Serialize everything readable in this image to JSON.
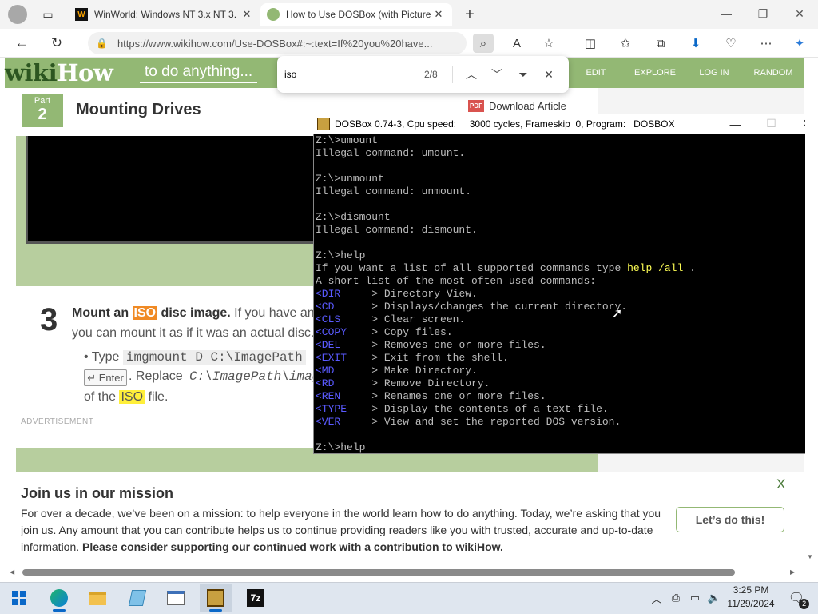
{
  "browser": {
    "tabs": [
      {
        "title": "WinWorld: Windows NT 3.x NT 3.",
        "favicon": "W",
        "active": false
      },
      {
        "title": "How to Use DOSBox (with Picture",
        "favicon": "",
        "active": true
      }
    ],
    "url": "https://www.wikihow.com/Use-DOSBox#:~:text=If%20you%20have..."
  },
  "find": {
    "query": "iso",
    "count": "2/8"
  },
  "wikihow": {
    "logo_wiki": "wiki",
    "logo_how": "How",
    "tagline": "to do anything...",
    "nav": [
      "EDIT",
      "EXPLORE",
      "LOG IN",
      "RANDOM"
    ],
    "part_label": "Part",
    "part_number": "2",
    "part_title": "Mounting Drives",
    "download": "Download Article",
    "step_number": "3",
    "step_bold_a": "Mount an ",
    "step_iso": "ISO",
    "step_bold_b": " disc image.",
    "step_rest": " If you have an",
    "step_line2": "you can mount it as if it was an actual disc.",
    "bullet_type": "Type ",
    "bullet_cmd": "imgmount D C:\\ImagePath",
    "enter_key": "↵ Enter",
    "replace_a": ". Replace ",
    "replace_path": "C:\\ImagePath\\image",
    "of_the": "of the ",
    "iso2": "ISO",
    "file": " file.",
    "advertisement": "ADVERTISEMENT"
  },
  "dosbox": {
    "title": "DOSBox 0.74-3, Cpu speed:     3000 cycles, Frameskip  0, Program:   DOSBOX",
    "lines": [
      {
        "t": "Z:\\>umount"
      },
      {
        "t": "Illegal command: umount."
      },
      {
        "t": ""
      },
      {
        "t": "Z:\\>unmount"
      },
      {
        "t": "Illegal command: unmount."
      },
      {
        "t": ""
      },
      {
        "t": "Z:\\>dismount"
      },
      {
        "t": "Illegal command: dismount."
      },
      {
        "t": ""
      },
      {
        "t": "Z:\\>help"
      },
      {
        "t": "If you want a list of all supported commands type ",
        "y": "help /all",
        "t2": " ."
      },
      {
        "t": "A short list of the most often used commands:"
      },
      {
        "b": "<DIR",
        "t": "     > Directory View."
      },
      {
        "b": "<CD",
        "t": "      > Displays/changes the current directory."
      },
      {
        "b": "<CLS",
        "t": "     > Clear screen."
      },
      {
        "b": "<COPY",
        "t": "    > Copy files."
      },
      {
        "b": "<DEL",
        "t": "     > Removes one or more files."
      },
      {
        "b": "<EXIT",
        "t": "    > Exit from the shell."
      },
      {
        "b": "<MD",
        "t": "      > Make Directory."
      },
      {
        "b": "<RD",
        "t": "      > Remove Directory."
      },
      {
        "b": "<REN",
        "t": "     > Renames one or more files."
      },
      {
        "b": "<TYPE",
        "t": "    > Display the contents of a text-file."
      },
      {
        "b": "<VER",
        "t": "     > View and set the reported DOS version."
      },
      {
        "t": ""
      },
      {
        "t": "Z:\\>help"
      }
    ]
  },
  "banner": {
    "title": "Join us in our mission",
    "text": "For over a decade, we’ve been on a mission: to help everyone in the world learn how to do anything. Today, we’re asking that you join us. Any amount that you can contribute helps us to continue providing readers like you with trusted, accurate and up-to-date information. ",
    "bold": "Please consider supporting our continued work with a contribution to wikiHow.",
    "button": "Let’s do this!",
    "close": "X"
  },
  "taskbar": {
    "apps": [
      "start",
      "edge",
      "explorer",
      "notepad",
      "list",
      "dosbox",
      "7z"
    ],
    "time": "3:25 PM",
    "date": "11/29/2024",
    "notifications": "2",
    "seven_zip": "7z"
  },
  "colors": {
    "wikihow_green": "#93b874",
    "dos_yellow": "#ffff55",
    "dos_blue": "#5a5aff",
    "find_highlight_current": "#f08a24",
    "find_highlight": "#ffef3a"
  }
}
